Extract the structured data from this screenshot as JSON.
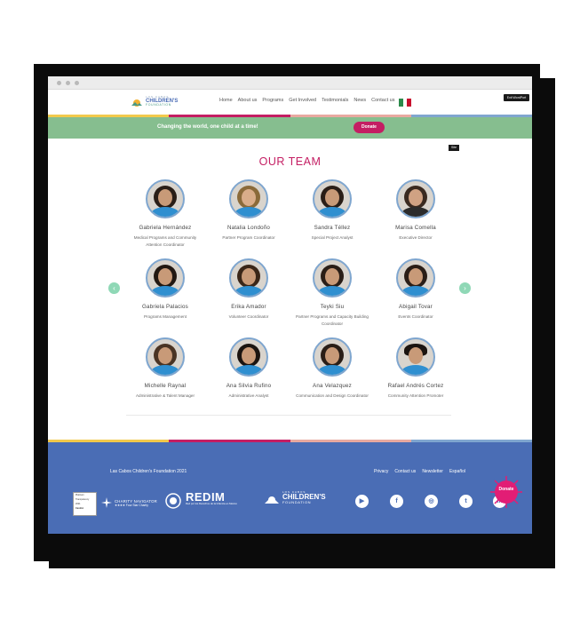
{
  "header": {
    "logo": {
      "line1": "LOS CABOS",
      "line2": "CHILDREN'S",
      "line3": "FOUNDATION"
    },
    "nav": [
      "Home",
      "About us",
      "Programs",
      "Get Involved",
      "Testimonials",
      "News",
      "Contact us"
    ],
    "exit_label": "Exit WordPort"
  },
  "stripe_colors": [
    "#f2c94c",
    "#c41e63",
    "#e8a9a0",
    "#7fa6cf"
  ],
  "banner": {
    "text": "Changing the world, one child at a time!",
    "donate_label": "Donate"
  },
  "site_badge": "Site",
  "team": {
    "title": "OUR TEAM",
    "members": [
      {
        "name": "Gabriela Hernández",
        "role": "Medical Programs and Community Attention Coordinator"
      },
      {
        "name": "Natalia Londoño",
        "role": "Partner Program Coordinator"
      },
      {
        "name": "Sandra Téllez",
        "role": "Special Project Analyst"
      },
      {
        "name": "Marisa Comella",
        "role": "Executive Director"
      },
      {
        "name": "Gabriela Palacios",
        "role": "Programs Management"
      },
      {
        "name": "Erika Amador",
        "role": "Volunteer Coordinator"
      },
      {
        "name": "Teyki Siu",
        "role": "Partner Programs and Capacity Building Coordinator"
      },
      {
        "name": "Abigail Tovar",
        "role": "Events Coordinator"
      },
      {
        "name": "Michelle Raynal",
        "role": "Administrative & Talent Manager"
      },
      {
        "name": "Ana Silvia Rufino",
        "role": "Administrative Analyst"
      },
      {
        "name": "Ana Velazquez",
        "role": "Communication and Design Coordinator"
      },
      {
        "name": "Rafael Andrés Cortez",
        "role": "Community Attention Promoter"
      }
    ]
  },
  "footer": {
    "copyright": "Las Cabos Children's Foundation 2021",
    "links": [
      "Privacy",
      "Contact us",
      "Newsletter",
      "Español"
    ],
    "donate_label": "Donate",
    "partners": {
      "guidestar": [
        "Platinum",
        "Transparency",
        "2021",
        "Candid."
      ],
      "charity_navigator": "CHARITY NAVIGATOR",
      "charity_sub": "★★★★ Four Star Charity",
      "reim": "REDIM",
      "reim_sub": "Red por los Derechos de la Infancia en México"
    },
    "social": [
      "youtube-icon",
      "facebook-icon",
      "instagram-icon",
      "twitter-icon",
      "linkedin-icon"
    ]
  }
}
